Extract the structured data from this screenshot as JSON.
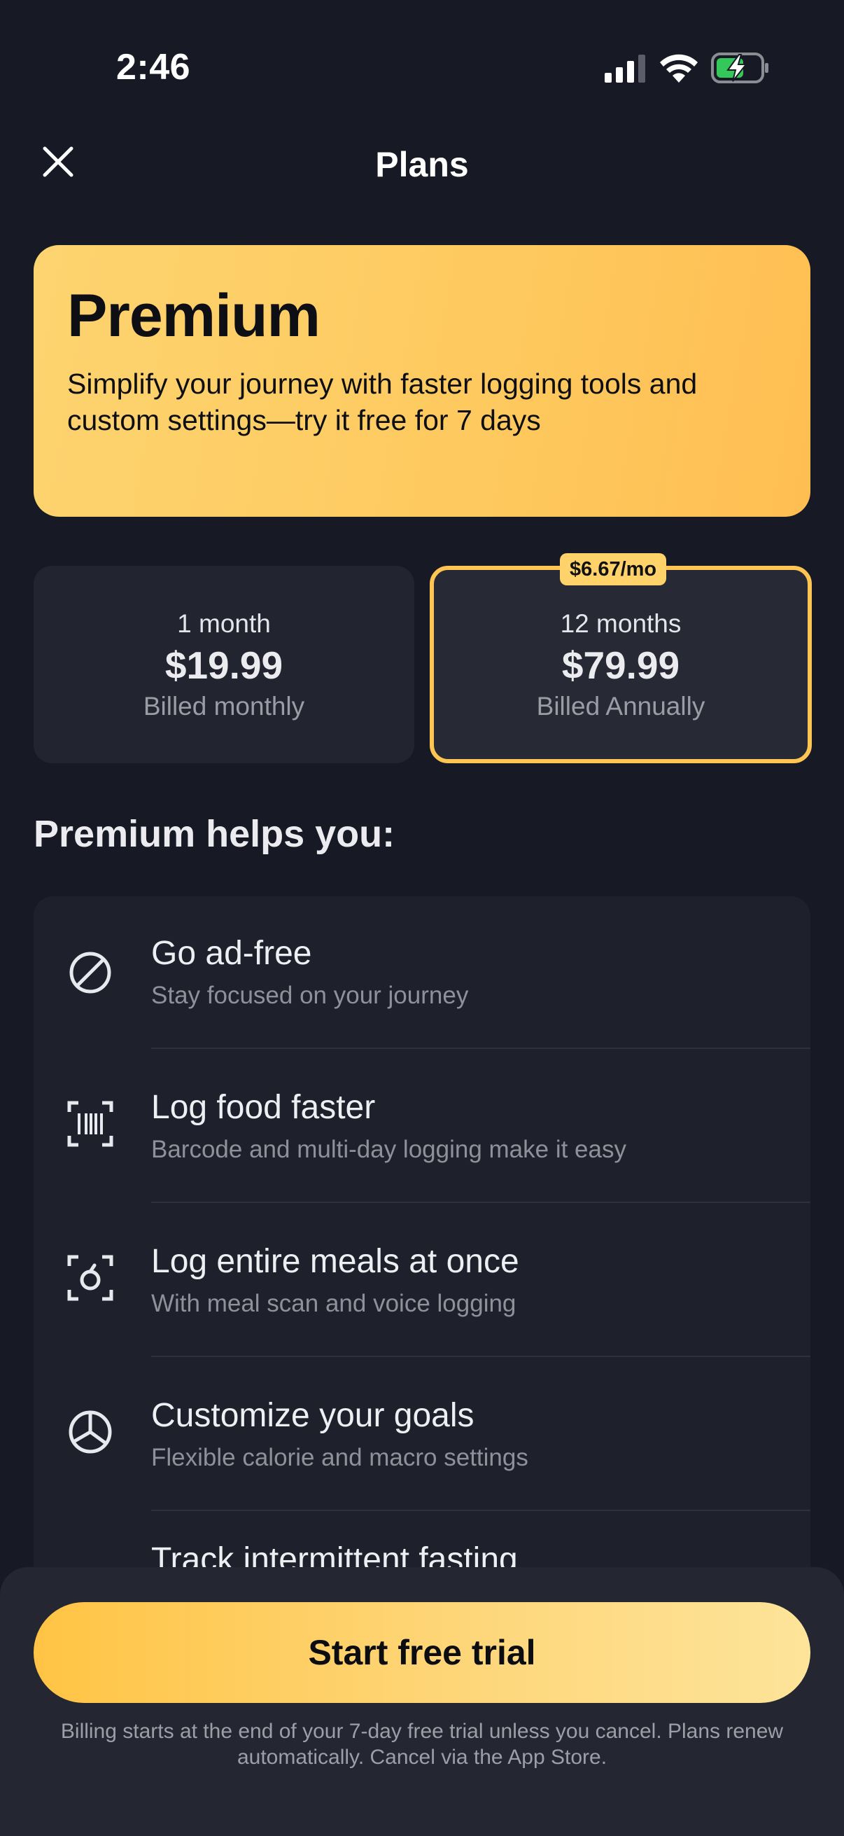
{
  "status_bar": {
    "time": "2:46"
  },
  "nav": {
    "title": "Plans"
  },
  "hero": {
    "title": "Premium",
    "description": "Simplify your journey with faster logging tools and custom settings—try it free for 7 days"
  },
  "plans": [
    {
      "duration": "1 month",
      "price": "$19.99",
      "billing": "Billed monthly",
      "selected": false
    },
    {
      "duration": "12 months",
      "price": "$79.99",
      "billing": "Billed Annually",
      "badge": "$6.67/mo",
      "selected": true
    }
  ],
  "features_heading": "Premium helps you:",
  "features": [
    {
      "icon": "ad-free-icon",
      "title": "Go ad-free",
      "subtitle": "Stay focused on your journey"
    },
    {
      "icon": "barcode-scan-icon",
      "title": "Log food faster",
      "subtitle": "Barcode and multi-day logging make it easy"
    },
    {
      "icon": "meal-scan-icon",
      "title": "Log entire meals at once",
      "subtitle": "With meal scan and voice logging"
    },
    {
      "icon": "pie-chart-icon",
      "title": "Customize your goals",
      "subtitle": "Flexible calorie and macro settings"
    },
    {
      "icon": "",
      "title": "Track intermittent fasting",
      "subtitle": ""
    }
  ],
  "cta": {
    "label": "Start free trial"
  },
  "legal": "Billing starts at the end of your 7-day free trial unless you cancel. Plans renew automatically. Cancel via the App Store.",
  "colors": {
    "background": "#171a24",
    "accent": "#ffc552",
    "card": "#1e212b"
  }
}
